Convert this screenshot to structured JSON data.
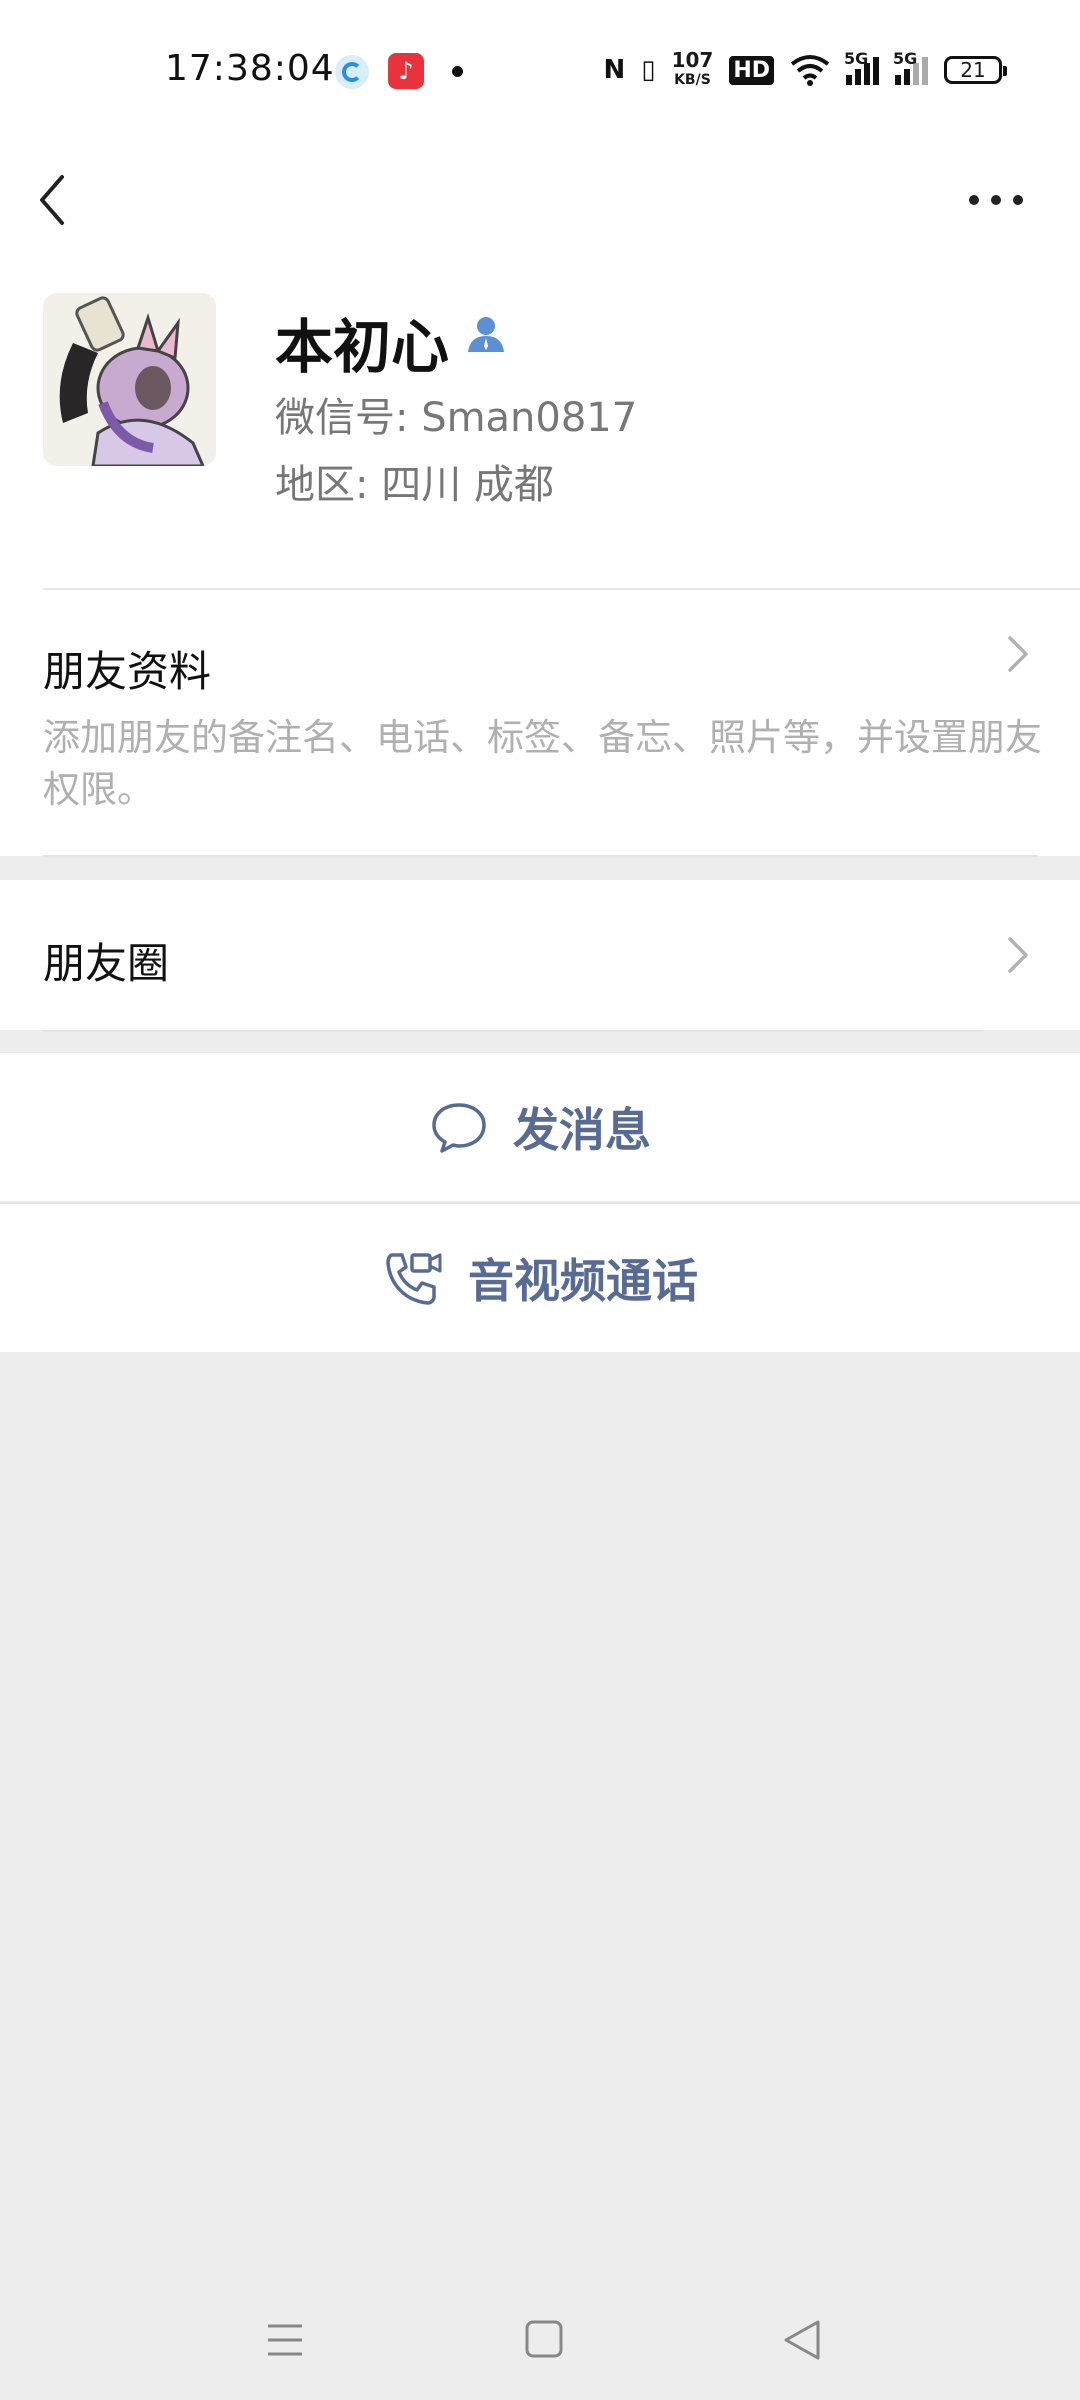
{
  "status_bar": {
    "time": "17:38:04",
    "speed_top": "107",
    "speed_bottom": "KB/S",
    "hd": "HD",
    "net1": "5G",
    "net2": "5G",
    "battery": "21"
  },
  "profile": {
    "nickname": "本初心",
    "wechat_id": "微信号: Sman0817",
    "region": "地区: 四川  成都"
  },
  "friend_info": {
    "title": "朋友资料",
    "description": "添加朋友的备注名、电话、标签、备忘、照片等，并设置朋友权限。"
  },
  "moments": {
    "title": "朋友圈"
  },
  "actions": {
    "message": "发消息",
    "call": "音视频通话"
  },
  "colors": {
    "link": "#576b95",
    "background": "#ededed"
  }
}
